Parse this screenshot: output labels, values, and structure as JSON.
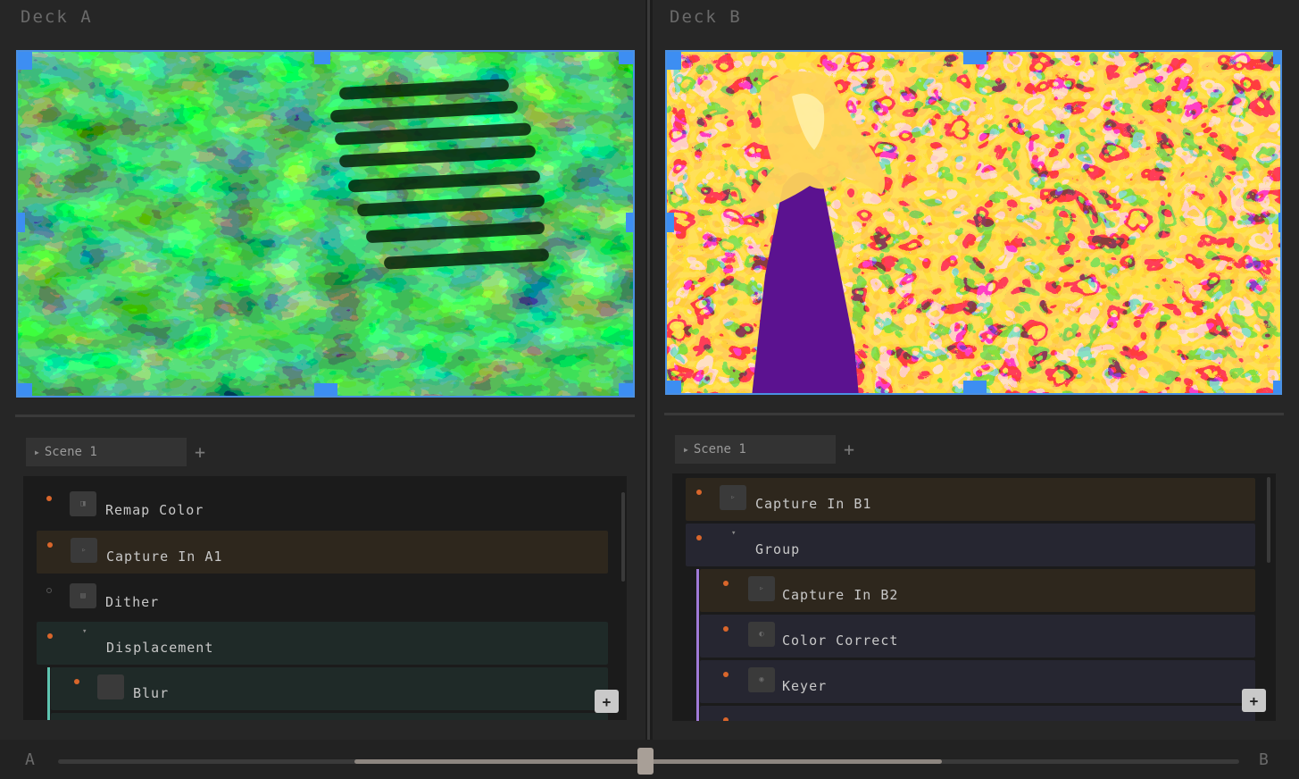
{
  "deck_a": {
    "title": "Deck A",
    "scene_tab": "Scene 1",
    "add_scene": "+",
    "layers": [
      {
        "label": "Remap Color",
        "thumb": "◨",
        "active": true,
        "style": "none"
      },
      {
        "label": "Capture In A1",
        "thumb": "▹",
        "active": true,
        "style": "capture"
      },
      {
        "label": "Dither",
        "thumb": "▤",
        "active": false,
        "style": "none"
      },
      {
        "label": "Displacement",
        "caret": "▾",
        "active": true,
        "style": "teal"
      },
      {
        "label": "Blur",
        "thumb": "",
        "active": true,
        "style": "teal"
      }
    ],
    "add_layer": "+"
  },
  "deck_b": {
    "title": "Deck B",
    "scene_tab": "Scene 1",
    "add_scene": "+",
    "layers": [
      {
        "label": "Capture In B1",
        "thumb": "▹",
        "active": true,
        "style": "capture"
      },
      {
        "label": "Group",
        "caret": "▾",
        "active": true,
        "style": "navy"
      },
      {
        "label": "Capture In B2",
        "thumb": "▹",
        "active": true,
        "style": "capture"
      },
      {
        "label": "Color Correct",
        "thumb": "◐",
        "active": true,
        "style": "navy"
      },
      {
        "label": "Keyer",
        "thumb": "◉",
        "active": true,
        "style": "navy"
      }
    ],
    "add_layer": "+"
  },
  "crossfader": {
    "left_label": "A",
    "right_label": "B",
    "position": 0.5
  },
  "colors": {
    "selection": "#3d8ef2",
    "active_dot": "#d9662b",
    "capture_row": "#2e271d",
    "teal_row": "#1f2a28",
    "navy_row": "#262631",
    "teal_nest": "#5ec4b0",
    "violet_nest": "#a07ad6"
  }
}
